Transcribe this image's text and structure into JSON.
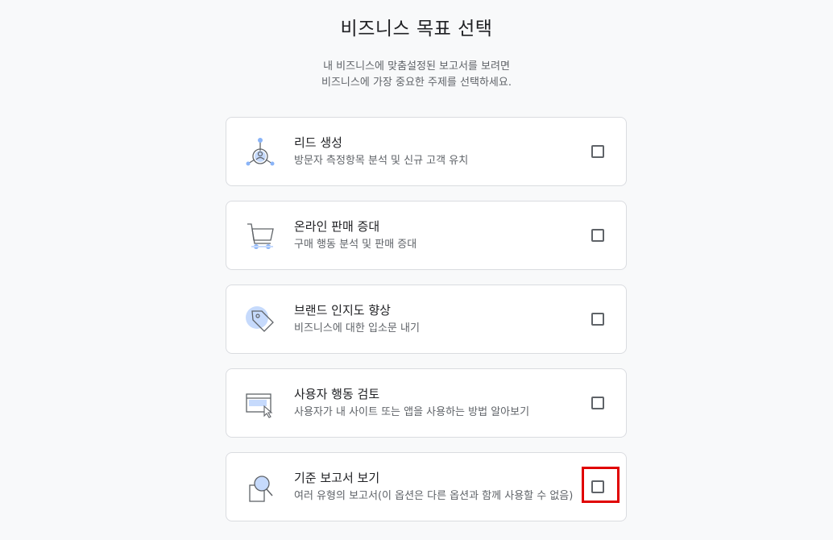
{
  "page": {
    "title": "비즈니스 목표 선택",
    "subtitle_line1": "내 비즈니스에 맞춤설정된 보고서를 보려면",
    "subtitle_line2": "비즈니스에 가장 중요한 주제를 선택하세요."
  },
  "options": [
    {
      "label": "리드 생성",
      "description": "방문자 측정항목 분석 및 신규 고객 유치",
      "icon": "lead-generation-icon",
      "checked": false
    },
    {
      "label": "온라인 판매 증대",
      "description": "구매 행동 분석 및 판매 증대",
      "icon": "shopping-cart-icon",
      "checked": false
    },
    {
      "label": "브랜드 인지도 향상",
      "description": "비즈니스에 대한 입소문 내기",
      "icon": "tag-icon",
      "checked": false
    },
    {
      "label": "사용자 행동 검토",
      "description": "사용자가 내 사이트 또는 앱을 사용하는 방법 알아보기",
      "icon": "browser-cursor-icon",
      "checked": false
    },
    {
      "label": "기준 보고서 보기",
      "description": "여러 유형의 보고서(이 옵션은 다른 옵션과 함께 사용할 수 없음)",
      "icon": "magnifier-report-icon",
      "checked": false
    }
  ],
  "colors": {
    "accent_light": "#c6dafc",
    "accent": "#8ab4f8",
    "highlight": "#e00000"
  }
}
